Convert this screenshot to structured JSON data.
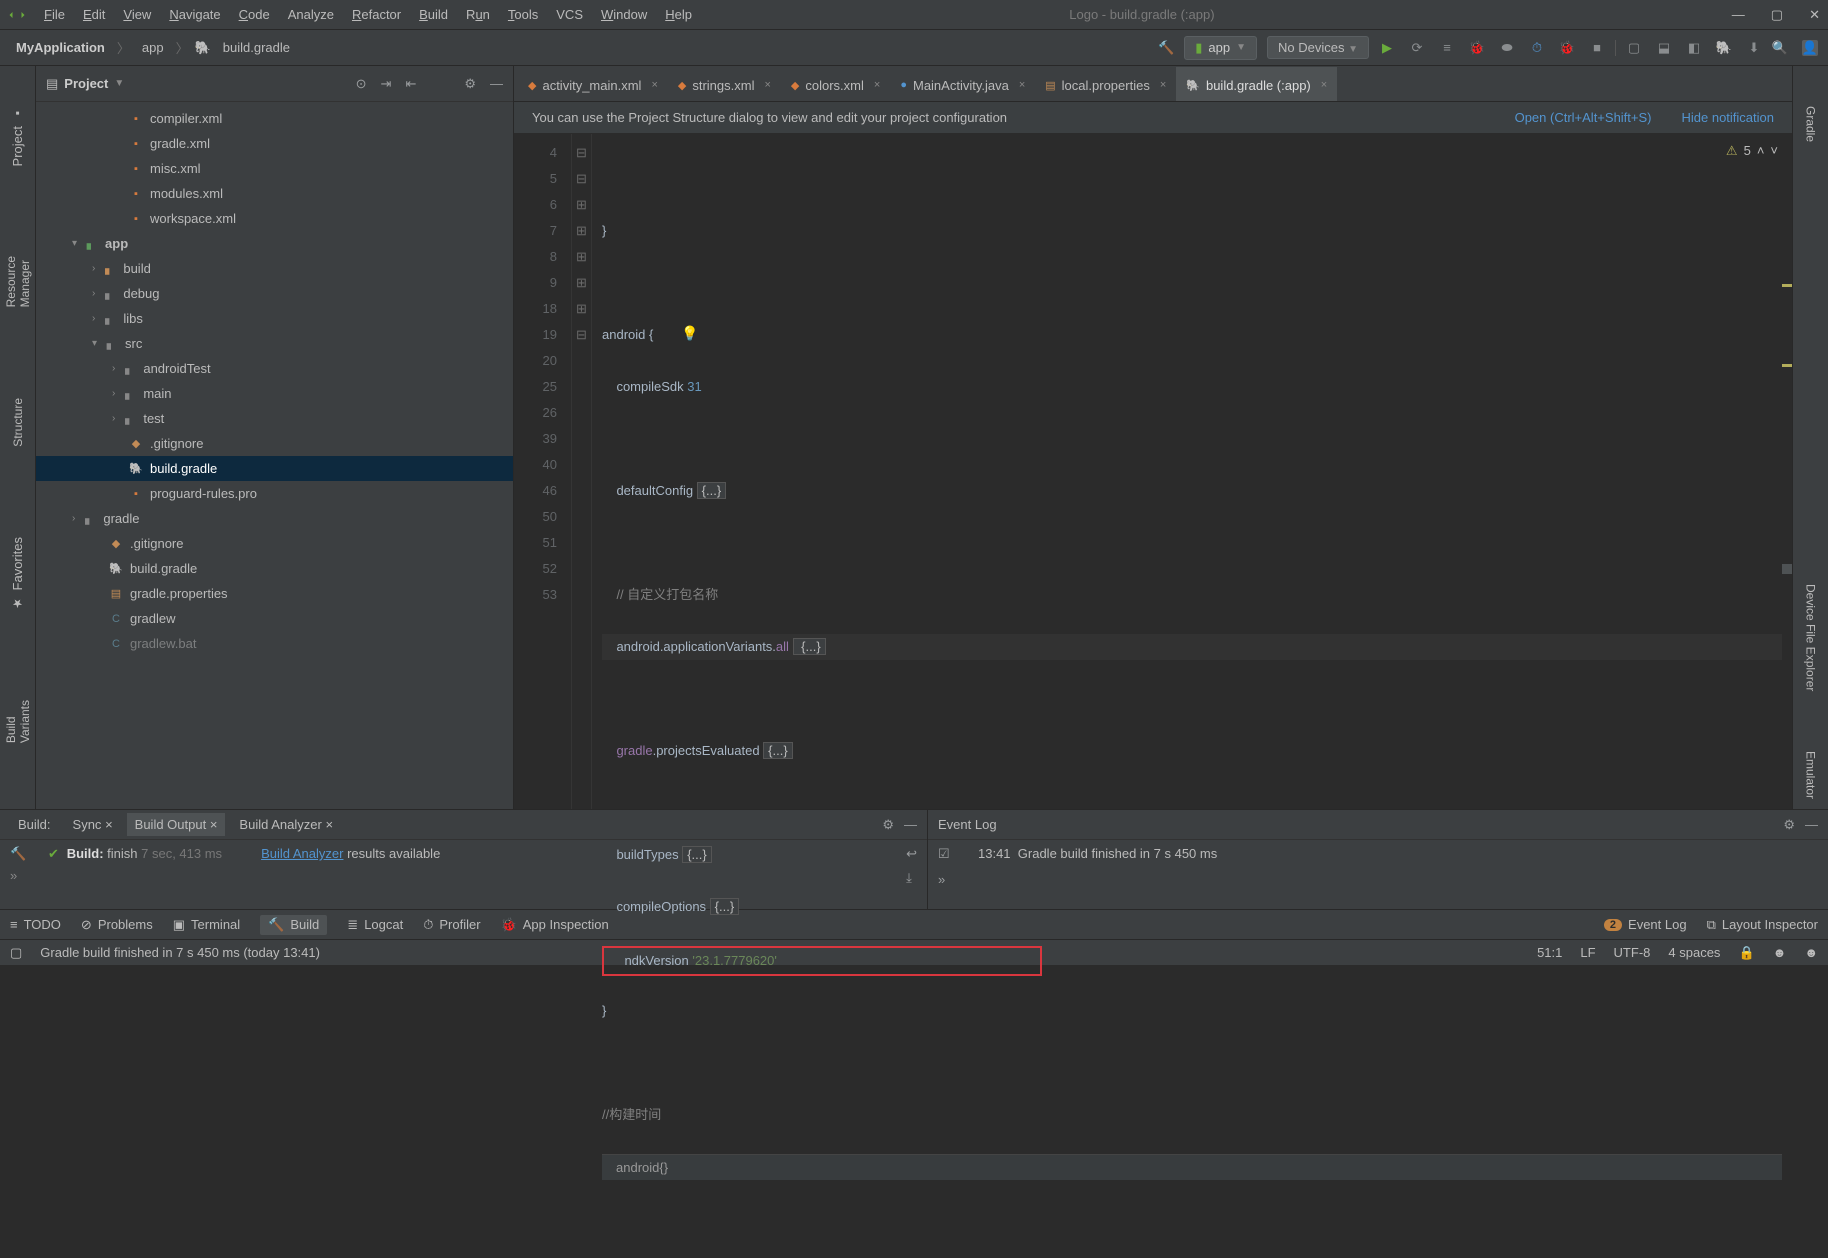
{
  "window_title": "Logo - build.gradle (:app)",
  "menus": [
    "File",
    "Edit",
    "View",
    "Navigate",
    "Code",
    "Analyze",
    "Refactor",
    "Build",
    "Run",
    "Tools",
    "VCS",
    "Window",
    "Help"
  ],
  "breadcrumbs": {
    "a": "MyApplication",
    "b": "app",
    "c": "build.gradle"
  },
  "run_config": "app",
  "devices": "No Devices",
  "side_left": {
    "project": "Project",
    "resmgr": "Resource Manager",
    "structure": "Structure",
    "favorites": "Favorites",
    "buildvar": "Build Variants"
  },
  "side_right": {
    "gradle": "Gradle",
    "dfe": "Device File Explorer",
    "emu": "Emulator"
  },
  "project_header": {
    "title": "Project"
  },
  "tree": [
    {
      "ind": 60,
      "icon": "file",
      "cls": "file",
      "name": "compiler.xml"
    },
    {
      "ind": 60,
      "icon": "file",
      "cls": "file",
      "name": "gradle.xml"
    },
    {
      "ind": 60,
      "icon": "file",
      "cls": "file",
      "name": "misc.xml"
    },
    {
      "ind": 60,
      "icon": "file",
      "cls": "file",
      "name": "modules.xml"
    },
    {
      "ind": 60,
      "icon": "file",
      "cls": "file",
      "name": "workspace.xml"
    },
    {
      "ind": 20,
      "arrow": "▾",
      "icon": "folder",
      "cls": "folder green",
      "name": "app",
      "bold": true
    },
    {
      "ind": 40,
      "arrow": "›",
      "icon": "folder",
      "cls": "folder orange",
      "name": "build"
    },
    {
      "ind": 40,
      "arrow": "›",
      "icon": "folder",
      "cls": "folder",
      "name": "debug"
    },
    {
      "ind": 40,
      "arrow": "›",
      "icon": "folder",
      "cls": "folder",
      "name": "libs"
    },
    {
      "ind": 40,
      "arrow": "▾",
      "icon": "folder",
      "cls": "folder",
      "name": "src"
    },
    {
      "ind": 60,
      "arrow": "›",
      "icon": "folder",
      "cls": "folder",
      "name": "androidTest"
    },
    {
      "ind": 60,
      "arrow": "›",
      "icon": "folder",
      "cls": "folder",
      "name": "main"
    },
    {
      "ind": 60,
      "arrow": "›",
      "icon": "folder",
      "cls": "folder",
      "name": "test"
    },
    {
      "ind": 60,
      "icon": "git",
      "cls": "prop",
      "name": ".gitignore"
    },
    {
      "ind": 60,
      "icon": "grad",
      "cls": "grad",
      "name": "build.gradle",
      "sel": true
    },
    {
      "ind": 60,
      "icon": "file",
      "cls": "file",
      "name": "proguard-rules.pro"
    },
    {
      "ind": 20,
      "arrow": "›",
      "icon": "folder",
      "cls": "folder",
      "name": "gradle"
    },
    {
      "ind": 40,
      "icon": "git",
      "cls": "prop",
      "name": ".gitignore"
    },
    {
      "ind": 40,
      "icon": "grad",
      "cls": "grad",
      "name": "build.gradle"
    },
    {
      "ind": 40,
      "icon": "prop",
      "cls": "prop",
      "name": "gradle.properties"
    },
    {
      "ind": 40,
      "icon": "sh",
      "cls": "grad",
      "name": "gradlew"
    },
    {
      "ind": 40,
      "icon": "sh",
      "cls": "grad",
      "name": "gradlew.bat",
      "dim": true
    }
  ],
  "editor_tabs": [
    {
      "icon": "xml",
      "label": "activity_main.xml"
    },
    {
      "icon": "xml",
      "label": "strings.xml"
    },
    {
      "icon": "xml",
      "label": "colors.xml"
    },
    {
      "icon": "java",
      "label": "MainActivity.java"
    },
    {
      "icon": "prop",
      "label": "local.properties"
    },
    {
      "icon": "grad",
      "label": "build.gradle (:app)",
      "active": true
    }
  ],
  "info_bar": {
    "msg": "You can use the Project Structure dialog to view and edit your project configuration",
    "open": "Open (Ctrl+Alt+Shift+S)",
    "hide": "Hide notification"
  },
  "inspection_count": "5",
  "gutter": [
    "4",
    "5",
    "6",
    "7",
    "8",
    "9",
    "18",
    "19",
    "20",
    "25",
    "26",
    "39",
    "40",
    "46",
    "50",
    "51",
    "52",
    "53",
    ""
  ],
  "code_lines": {
    "l4": "}",
    "l6_a": "android",
    "l6_b": " {",
    "l7_a": "    compileSdk ",
    "l7_b": "31",
    "l9_a": "    defaultConfig ",
    "l9_b": "{...}",
    "l19": "    // 自定义打包名称",
    "l20_a": "    android.applicationVariants.",
    "l20_b": "all",
    "l20_c": " {...}",
    "l26_a": "    gradle",
    "l26_b": ".projectsEvaluated ",
    "l26_c": "{...}",
    "l40_a": "    buildTypes ",
    "l40_b": "{...}",
    "l46_a": "    compileOptions ",
    "l46_b": "{...}",
    "l50_a": "    ndkVersion ",
    "l50_b": "'23.1.7779620'",
    "l51": "}",
    "l53": "//构建时间",
    "crumb": "android{}"
  },
  "build_pane": {
    "label": "Build:",
    "tabs": {
      "sync": "Sync",
      "output": "Build Output",
      "analyzer": "Build Analyzer"
    },
    "line_bold": "Build:",
    "line_rest": " finish",
    "time": " 7 sec, 413 ms",
    "analyzer_link": "Build Analyzer",
    "analyzer_rest": " results available"
  },
  "event_log": {
    "title": "Event Log",
    "time": "13:41",
    "msg": "Gradle build finished in 7 s 450 ms"
  },
  "bottom_tabs": {
    "todo": "TODO",
    "problems": "Problems",
    "terminal": "Terminal",
    "build": "Build",
    "logcat": "Logcat",
    "profiler": "Profiler",
    "appinsp": "App Inspection",
    "eventlog": "Event Log",
    "layoutinsp": "Layout Inspector"
  },
  "event_badge": "2",
  "status": {
    "msg": "Gradle build finished in 7 s 450 ms (today 13:41)",
    "pos": "51:1",
    "le": "LF",
    "enc": "UTF-8",
    "indent": "4 spaces"
  }
}
